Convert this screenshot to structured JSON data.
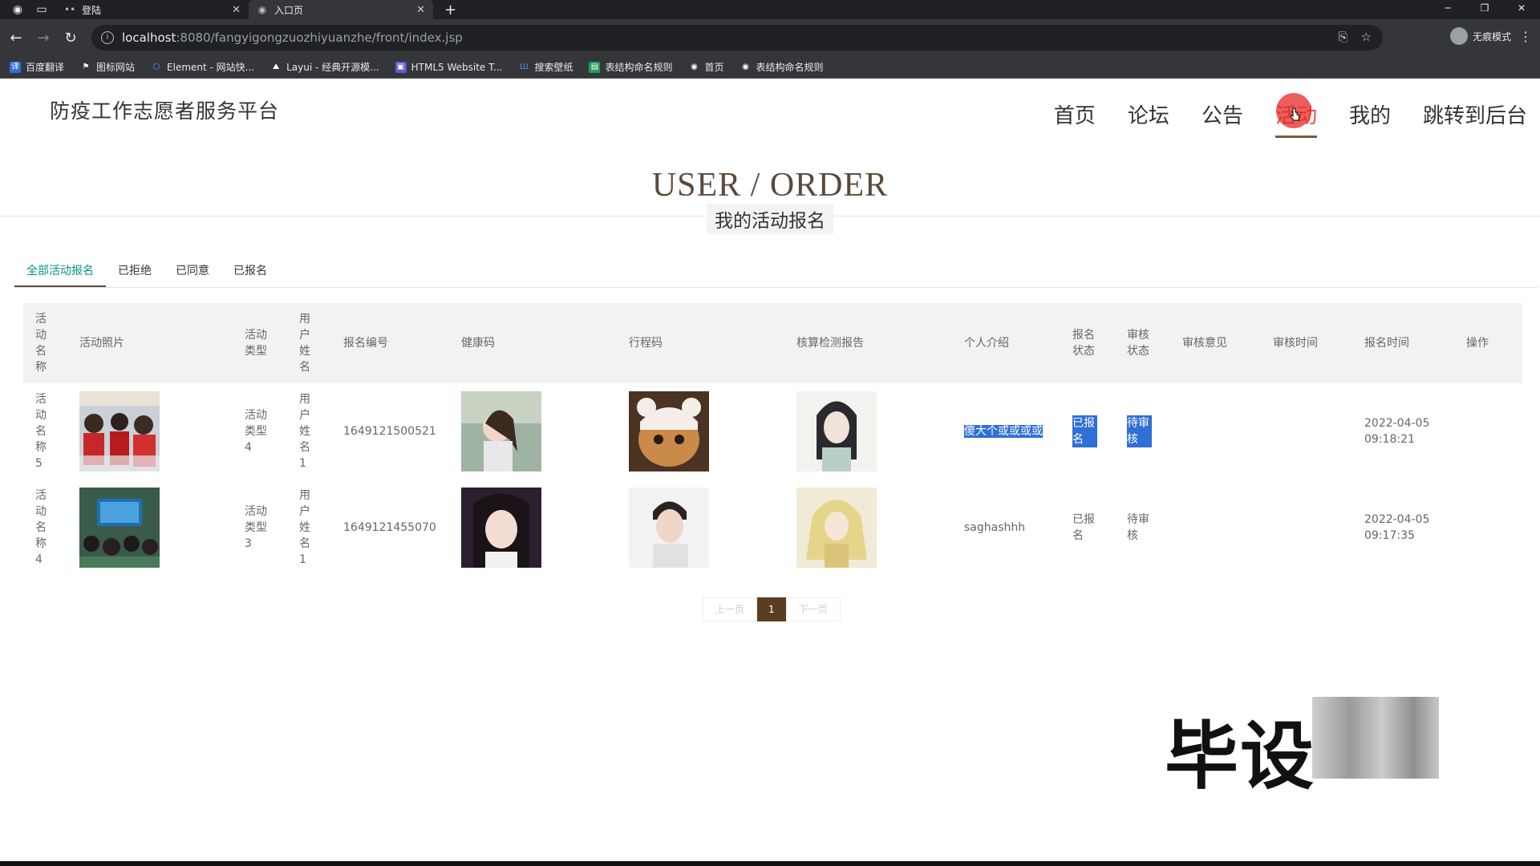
{
  "browser": {
    "tabs": [
      {
        "title": "登陆",
        "active": false
      },
      {
        "title": "入口页",
        "active": true
      }
    ],
    "url_host": "localhost",
    "url_path": ":8080/fangyigongzuozhiyuanzhe/front/index.jsp",
    "profile_label": "无痕模式",
    "bookmarks": [
      "百度翻译",
      "图标网站",
      "Element - 网站快...",
      "Layui - 经典开源模...",
      "HTML5 Website T...",
      "搜索壁纸",
      "表结构命名规则",
      "首页",
      "表结构命名规则"
    ]
  },
  "site": {
    "title": "防疫工作志愿者服务平台",
    "nav": [
      "首页",
      "论坛",
      "公告",
      "活动",
      "我的",
      "跳转到后台"
    ],
    "active_nav": "活动"
  },
  "heading": {
    "title": "USER / ORDER",
    "subtitle": "我的活动报名"
  },
  "filter_tabs": [
    "全部活动报名",
    "已拒绝",
    "已同意",
    "已报名"
  ],
  "active_filter": "全部活动报名",
  "table": {
    "columns": [
      "活动名称",
      "活动照片",
      "活动类型",
      "用户姓名",
      "报名编号",
      "健康码",
      "行程码",
      "核算检测报告",
      "个人介绍",
      "报名状态",
      "审核状态",
      "审核意见",
      "审核时间",
      "报名时间",
      "操作"
    ],
    "rows": [
      {
        "name": "活动名称5",
        "type": "活动类型4",
        "user": "用户姓名1",
        "number": "1649121500521",
        "intro": "傻大个或或或或",
        "signup_status": "已报名",
        "review_status": "待审核",
        "review_opinion": "",
        "review_time": "",
        "signup_date": "2022-04-05",
        "signup_clock": "09:18:21",
        "selected": true
      },
      {
        "name": "活动名称4",
        "type": "活动类型3",
        "user": "用户姓名1",
        "number": "1649121455070",
        "intro": "saghashhh",
        "signup_status": "已报名",
        "review_status": "待审核",
        "review_opinion": "",
        "review_time": "",
        "signup_date": "2022-04-05",
        "signup_clock": "09:17:35",
        "selected": false
      }
    ]
  },
  "pager": {
    "prev": "上一页",
    "current": "1",
    "next": "下一页"
  },
  "watermark": "毕设"
}
